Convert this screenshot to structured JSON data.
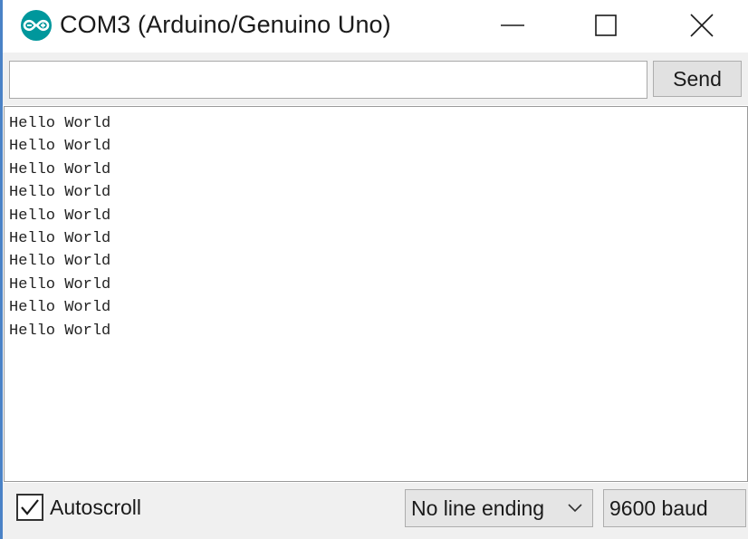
{
  "window": {
    "title": "COM3 (Arduino/Genuino Uno)",
    "icon": "arduino-logo-icon",
    "controls": [
      "minimize-icon",
      "maximize-icon",
      "close-icon"
    ]
  },
  "input_row": {
    "input_value": "",
    "send_label": "Send"
  },
  "output": {
    "lines": [
      "Hello World",
      "Hello World",
      "Hello World",
      "Hello World",
      "Hello World",
      "Hello World",
      "Hello World",
      "Hello World",
      "Hello World",
      "Hello World"
    ]
  },
  "status_bar": {
    "autoscroll_label": "Autoscroll",
    "autoscroll_checked": true,
    "line_ending_selected": "No line ending",
    "baud_selected": "9600 baud"
  },
  "colors": {
    "arduino_teal": "#00979c",
    "window_border": "#4a82c6",
    "panel_bg": "#f0f0f0"
  }
}
